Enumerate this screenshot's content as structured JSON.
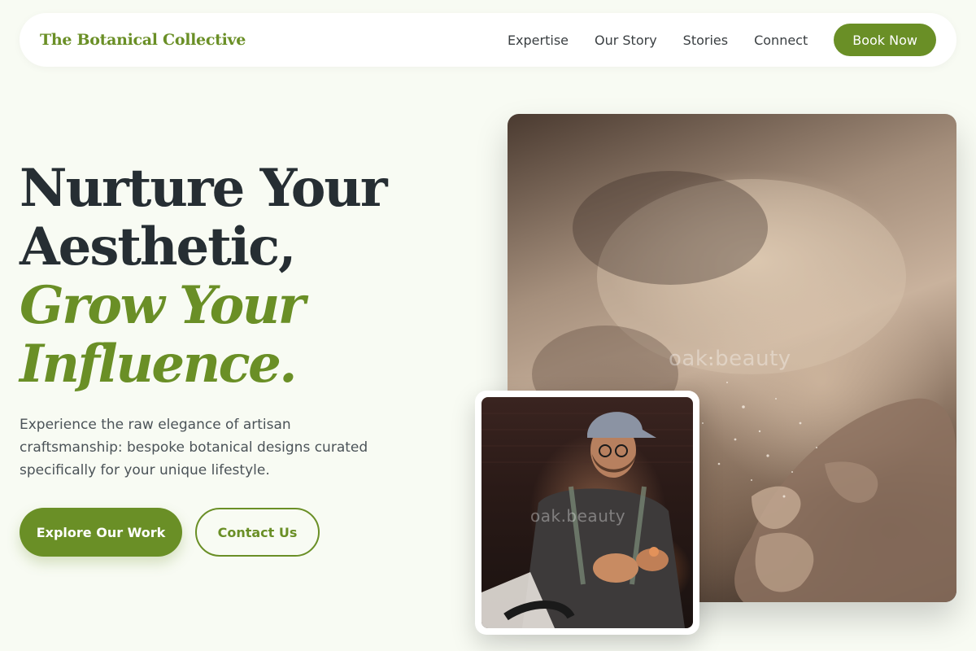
{
  "nav": {
    "logo": "The Botanical Collective",
    "links": [
      "Expertise",
      "Our Story",
      "Stories",
      "Connect"
    ],
    "cta": "Book Now"
  },
  "hero": {
    "headline_line1": "Nurture Your",
    "headline_line2": "Aesthetic,",
    "headline_accent1": "Grow Your",
    "headline_accent2": "Influence.",
    "lead": "Experience the raw elegance of artisan craftsmanship: bespoke botanical designs curated specifically for your unique lifestyle.",
    "primary_cta": "Explore Our Work",
    "secondary_cta": "Contact Us"
  },
  "images": {
    "main_watermark": "oak.beauty",
    "small_watermark": "oak.beauty"
  },
  "colors": {
    "accent": "#6a8f26",
    "background": "#f8fbf3",
    "heading": "#262e33",
    "body_text": "#4b5358"
  }
}
